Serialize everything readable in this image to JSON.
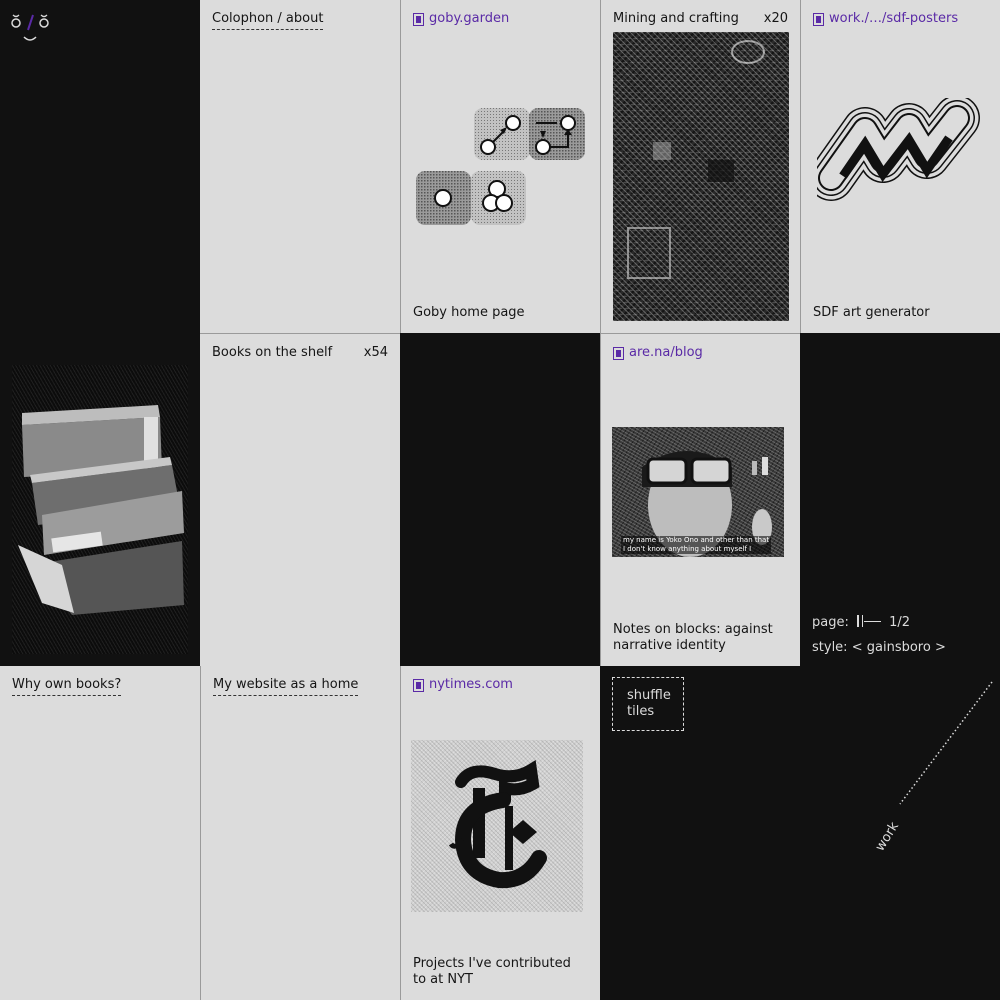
{
  "logo": {
    "glyph": "ŏ/ŏ"
  },
  "tiles": {
    "colophon": {
      "title": "Colophon / about"
    },
    "goby": {
      "link": "goby.garden",
      "caption": "Goby home page"
    },
    "mining": {
      "title": "Mining and crafting",
      "count": "x20"
    },
    "sdf": {
      "link": "work./…/sdf-posters",
      "caption": "SDF art generator"
    },
    "books": {
      "title": "Books on the shelf",
      "count": "x54"
    },
    "arena": {
      "link": "are.na/blog",
      "caption": "Notes on blocks: against narrative identity",
      "subtitle_line1": "my name is Yoko Ono and other than that",
      "subtitle_line2": "I don't know anything about myself I"
    },
    "why_books": {
      "title": "Why own books?"
    },
    "website_home": {
      "title": "My website as a home"
    },
    "nyt": {
      "link": "nytimes.com",
      "caption": "Projects I've contributed to at NYT"
    }
  },
  "controls": {
    "shuffle_label": "shuffle tiles",
    "page_label": "page:",
    "page_value": "1/2",
    "style_label": "style:",
    "style_prev": "<",
    "style_value": "gainsboro",
    "style_next": ">"
  },
  "decor": {
    "work_label": "work"
  },
  "colors": {
    "tile_bg": "#dcdcdc",
    "dark_bg": "#111111",
    "link": "#5a2aa6"
  }
}
